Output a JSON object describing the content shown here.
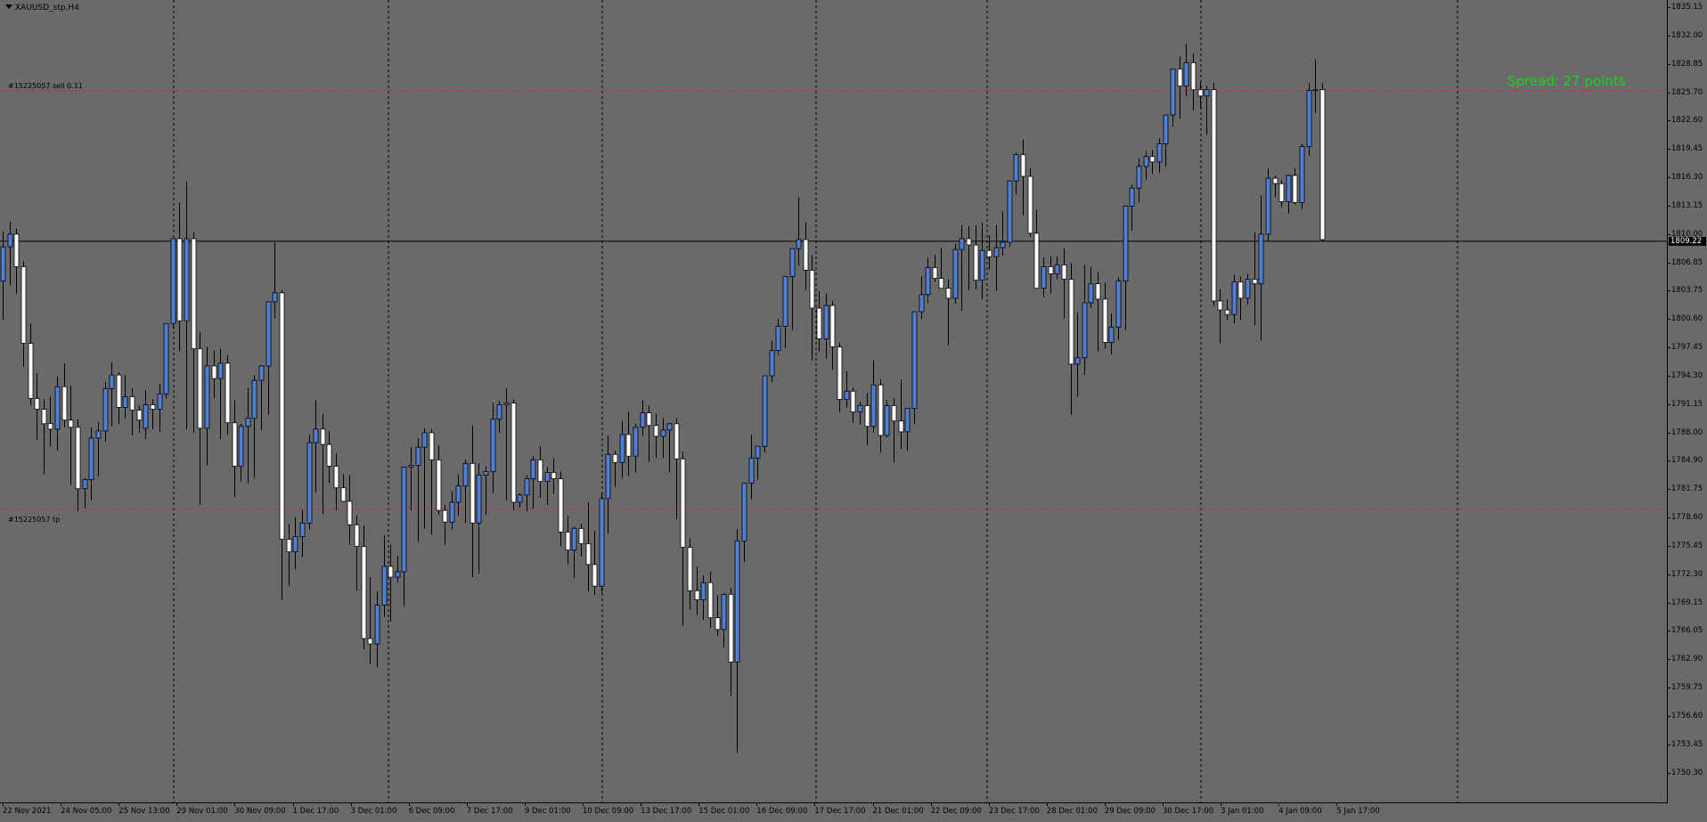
{
  "window": {
    "title": "XAUUSD_stp,H4",
    "menu_icon": "triangle-down-icon"
  },
  "colors": {
    "background": "#6a6a6a",
    "bull_body": "#4f7fd6",
    "bear_body": "#ffffff",
    "wick": "#000000",
    "order_line": "#c83232",
    "grid": "#000000",
    "spread_text": "#1cd41c"
  },
  "orders": {
    "entry_label": "#15225057 sell 0.11",
    "tp_label": "#15225057 tp",
    "entry_price": 1825.9,
    "tp_price": 1779.6
  },
  "spread_text": "Spread: 27 points",
  "bid_price": "1809.22",
  "price_axis": {
    "ticks": [
      "1835.15",
      "1832.00",
      "1828.85",
      "1825.70",
      "1822.60",
      "1819.45",
      "1816.30",
      "1813.15",
      "1810.00",
      "1806.85",
      "1803.75",
      "1800.60",
      "1797.45",
      "1794.30",
      "1791.15",
      "1788.00",
      "1784.90",
      "1781.75",
      "1778.60",
      "1775.45",
      "1772.30",
      "1769.15",
      "1766.05",
      "1762.90",
      "1759.75",
      "1756.60",
      "1753.45",
      "1750.30"
    ]
  },
  "time_axis": {
    "labels": [
      "22 Nov 2021",
      "24 Nov 05:00",
      "25 Nov 13:00",
      "29 Nov 01:00",
      "30 Nov 09:00",
      "1 Dec 17:00",
      "3 Dec 01:00",
      "6 Dec 09:00",
      "7 Dec 17:00",
      "9 Dec 01:00",
      "10 Dec 09:00",
      "13 Dec 17:00",
      "15 Dec 01:00",
      "16 Dec 09:00",
      "17 Dec 17:00",
      "21 Dec 01:00",
      "22 Dec 09:00",
      "23 Dec 17:00",
      "28 Dec 01:00",
      "29 Dec 09:00",
      "30 Dec 17:00",
      "3 Jan 01:00",
      "4 Jan 09:00",
      "5 Jan 17:00"
    ]
  },
  "chart_data": {
    "type": "candlestick",
    "symbol": "XAUUSD_stp",
    "timeframe": "H4",
    "ylim": [
      1750.3,
      1835.15
    ],
    "grid": "vertical-dashed",
    "candles": [
      [
        1804.8,
        1810.3,
        1800.5,
        1808.6
      ],
      [
        1808.6,
        1811.4,
        1804.3,
        1810.0
      ],
      [
        1810.0,
        1810.6,
        1803.4,
        1806.4
      ],
      [
        1806.4,
        1807.0,
        1795.3,
        1797.9
      ],
      [
        1797.9,
        1800.1,
        1791.0,
        1791.8
      ],
      [
        1791.8,
        1794.6,
        1787.2,
        1790.6
      ],
      [
        1790.6,
        1791.7,
        1783.4,
        1789.0
      ],
      [
        1789.0,
        1792.0,
        1786.5,
        1788.4
      ],
      [
        1788.4,
        1794.2,
        1786.0,
        1793.1
      ],
      [
        1793.1,
        1795.7,
        1788.6,
        1789.4
      ],
      [
        1789.4,
        1793.2,
        1782.2,
        1788.6
      ],
      [
        1788.6,
        1789.5,
        1779.3,
        1781.8
      ],
      [
        1781.8,
        1783.0,
        1779.6,
        1782.8
      ],
      [
        1782.8,
        1788.6,
        1780.5,
        1787.4
      ],
      [
        1787.4,
        1789.2,
        1783.2,
        1788.2
      ],
      [
        1788.2,
        1793.6,
        1787.0,
        1792.9
      ],
      [
        1792.9,
        1795.8,
        1788.7,
        1794.4
      ],
      [
        1794.4,
        1794.7,
        1789.0,
        1790.8
      ],
      [
        1790.8,
        1794.4,
        1789.6,
        1792.0
      ],
      [
        1792.0,
        1792.9,
        1787.7,
        1790.5
      ],
      [
        1790.5,
        1791.0,
        1788.0,
        1789.4
      ],
      [
        1788.5,
        1792.7,
        1787.3,
        1791.1
      ],
      [
        1791.1,
        1791.7,
        1788.4,
        1790.6
      ],
      [
        1790.6,
        1793.4,
        1788.1,
        1792.3
      ],
      [
        1792.3,
        1796.9,
        1791.7,
        1800.1
      ],
      [
        1800.1,
        1805.3,
        1799.5,
        1809.5
      ],
      [
        1809.5,
        1813.5,
        1797.0,
        1800.4
      ],
      [
        1800.4,
        1815.8,
        1788.4,
        1809.5
      ],
      [
        1809.5,
        1810.2,
        1788.0,
        1797.3
      ],
      [
        1797.3,
        1799.1,
        1780.0,
        1788.5
      ],
      [
        1788.5,
        1797.5,
        1784.4,
        1795.4
      ],
      [
        1795.4,
        1797.1,
        1791.8,
        1794.0
      ],
      [
        1794.0,
        1797.3,
        1787.3,
        1795.7
      ],
      [
        1795.7,
        1796.6,
        1787.8,
        1789.1
      ],
      [
        1789.1,
        1791.6,
        1780.9,
        1784.3
      ],
      [
        1784.3,
        1789.0,
        1782.6,
        1788.7
      ],
      [
        1788.7,
        1793.0,
        1782.4,
        1789.6
      ],
      [
        1789.6,
        1794.4,
        1783.0,
        1793.8
      ],
      [
        1793.8,
        1795.5,
        1788.3,
        1795.4
      ],
      [
        1795.4,
        1801.0,
        1790.0,
        1802.5
      ],
      [
        1802.5,
        1809.1,
        1800.7,
        1803.5
      ],
      [
        1803.5,
        1803.8,
        1769.5,
        1776.2
      ],
      [
        1776.2,
        1777.9,
        1771.0,
        1774.8
      ],
      [
        1774.8,
        1778.6,
        1772.9,
        1776.5
      ],
      [
        1776.5,
        1779.4,
        1774.2,
        1778.0
      ],
      [
        1778.0,
        1787.8,
        1777.3,
        1786.9
      ],
      [
        1786.9,
        1791.6,
        1781.4,
        1788.4
      ],
      [
        1788.4,
        1790.1,
        1779.0,
        1786.7
      ],
      [
        1786.7,
        1788.2,
        1782.4,
        1784.3
      ],
      [
        1784.3,
        1785.7,
        1779.4,
        1781.9
      ],
      [
        1781.9,
        1783.4,
        1780.6,
        1780.4
      ],
      [
        1780.4,
        1783.3,
        1775.6,
        1777.8
      ],
      [
        1777.8,
        1778.8,
        1770.5,
        1775.4
      ],
      [
        1775.4,
        1777.7,
        1764.0,
        1765.2
      ],
      [
        1765.2,
        1772.0,
        1762.4,
        1764.6
      ],
      [
        1764.6,
        1770.4,
        1762.0,
        1768.9
      ],
      [
        1768.9,
        1776.6,
        1767.6,
        1773.2
      ],
      [
        1773.2,
        1775.6,
        1767.1,
        1772.0
      ],
      [
        1772.0,
        1774.4,
        1771.4,
        1772.6
      ],
      [
        1772.6,
        1783.6,
        1768.8,
        1784.2
      ],
      [
        1784.2,
        1786.4,
        1779.4,
        1784.4
      ],
      [
        1784.4,
        1787.4,
        1775.9,
        1786.4
      ],
      [
        1786.4,
        1788.5,
        1777.4,
        1788.0
      ],
      [
        1788.0,
        1788.4,
        1776.7,
        1785.0
      ],
      [
        1785.0,
        1786.6,
        1778.9,
        1779.4
      ],
      [
        1779.4,
        1780.0,
        1775.6,
        1778.1
      ],
      [
        1778.1,
        1781.5,
        1777.3,
        1780.3
      ],
      [
        1780.3,
        1783.4,
        1778.8,
        1782.1
      ],
      [
        1782.1,
        1785.0,
        1778.0,
        1784.6
      ],
      [
        1784.6,
        1788.8,
        1772.0,
        1778.0
      ],
      [
        1778.0,
        1784.6,
        1772.4,
        1783.3
      ],
      [
        1783.3,
        1784.3,
        1778.9,
        1783.7
      ],
      [
        1783.7,
        1791.3,
        1781.3,
        1789.5
      ],
      [
        1789.5,
        1791.5,
        1788.0,
        1791.1
      ],
      [
        1791.1,
        1792.9,
        1780.5,
        1791.3
      ],
      [
        1791.3,
        1791.7,
        1779.4,
        1780.3
      ],
      [
        1780.3,
        1781.3,
        1779.7,
        1781.1
      ],
      [
        1781.1,
        1783.3,
        1779.3,
        1782.9
      ],
      [
        1782.9,
        1785.4,
        1779.6,
        1785.0
      ],
      [
        1785.0,
        1786.5,
        1780.8,
        1782.6
      ],
      [
        1782.6,
        1784.2,
        1780.0,
        1783.6
      ],
      [
        1783.6,
        1785.2,
        1781.2,
        1782.9
      ],
      [
        1782.9,
        1783.7,
        1775.4,
        1777.0
      ],
      [
        1777.0,
        1778.8,
        1773.4,
        1775.0
      ],
      [
        1775.0,
        1777.6,
        1771.9,
        1777.4
      ],
      [
        1777.4,
        1777.9,
        1774.3,
        1775.7
      ],
      [
        1775.7,
        1780.3,
        1770.4,
        1773.4
      ],
      [
        1773.4,
        1777.1,
        1770.0,
        1771.0
      ],
      [
        1771.0,
        1781.2,
        1770.2,
        1780.7
      ],
      [
        1780.7,
        1787.7,
        1776.8,
        1785.6
      ],
      [
        1785.6,
        1786.0,
        1782.0,
        1784.7
      ],
      [
        1784.7,
        1789.3,
        1783.0,
        1787.8
      ],
      [
        1787.8,
        1790.3,
        1783.2,
        1785.4
      ],
      [
        1785.4,
        1789.0,
        1783.6,
        1788.6
      ],
      [
        1788.6,
        1791.6,
        1787.6,
        1790.2
      ],
      [
        1790.2,
        1791.0,
        1784.8,
        1788.8
      ],
      [
        1788.8,
        1790.1,
        1785.2,
        1787.6
      ],
      [
        1787.6,
        1789.6,
        1785.2,
        1788.3
      ],
      [
        1788.3,
        1789.0,
        1783.6,
        1789.0
      ],
      [
        1789.0,
        1789.6,
        1778.4,
        1785.1
      ],
      [
        1785.1,
        1785.9,
        1766.6,
        1775.3
      ],
      [
        1775.3,
        1776.3,
        1768.4,
        1770.5
      ],
      [
        1770.5,
        1773.2,
        1767.8,
        1769.5
      ],
      [
        1769.5,
        1772.2,
        1767.3,
        1771.4
      ],
      [
        1771.4,
        1772.6,
        1766.4,
        1767.5
      ],
      [
        1767.5,
        1770.0,
        1765.5,
        1766.2
      ],
      [
        1766.2,
        1770.2,
        1764.2,
        1770.1
      ],
      [
        1770.1,
        1770.8,
        1758.8,
        1762.6
      ],
      [
        1762.6,
        1777.3,
        1752.5,
        1776.0
      ],
      [
        1776.0,
        1782.1,
        1773.7,
        1782.4
      ],
      [
        1782.4,
        1787.8,
        1780.6,
        1785.2
      ],
      [
        1785.2,
        1786.4,
        1782.8,
        1786.5
      ],
      [
        1786.5,
        1794.3,
        1785.8,
        1794.3
      ],
      [
        1794.3,
        1798.2,
        1793.6,
        1797.1
      ],
      [
        1797.1,
        1800.6,
        1796.6,
        1799.8
      ],
      [
        1799.8,
        1804.3,
        1797.4,
        1805.3
      ],
      [
        1805.3,
        1806.2,
        1799.4,
        1808.4
      ],
      [
        1808.4,
        1814.1,
        1806.5,
        1809.4
      ],
      [
        1809.4,
        1811.3,
        1803.8,
        1806.0
      ],
      [
        1806.0,
        1807.7,
        1796.0,
        1801.8
      ],
      [
        1801.8,
        1803.7,
        1797.0,
        1798.4
      ],
      [
        1798.4,
        1803.4,
        1796.2,
        1802.1
      ],
      [
        1802.1,
        1802.6,
        1795.0,
        1797.5
      ],
      [
        1797.5,
        1798.0,
        1790.3,
        1791.7
      ],
      [
        1791.7,
        1794.8,
        1790.8,
        1792.6
      ],
      [
        1792.6,
        1793.0,
        1789.1,
        1790.3
      ],
      [
        1790.3,
        1791.4,
        1788.9,
        1791.0
      ],
      [
        1791.0,
        1792.4,
        1786.6,
        1788.7
      ],
      [
        1788.7,
        1796.0,
        1788.0,
        1793.3
      ],
      [
        1793.3,
        1793.9,
        1785.8,
        1787.7
      ],
      [
        1787.7,
        1791.6,
        1787.5,
        1791.0
      ],
      [
        1791.0,
        1791.8,
        1784.7,
        1789.3
      ],
      [
        1789.3,
        1793.9,
        1786.2,
        1788.1
      ],
      [
        1788.1,
        1789.7,
        1786.0,
        1790.7
      ],
      [
        1790.7,
        1801.3,
        1789.0,
        1801.4
      ],
      [
        1801.4,
        1805.3,
        1800.6,
        1803.3
      ],
      [
        1803.3,
        1807.4,
        1802.4,
        1806.3
      ],
      [
        1806.3,
        1807.7,
        1804.7,
        1805.1
      ],
      [
        1805.1,
        1808.5,
        1804.0,
        1804.0
      ],
      [
        1804.0,
        1805.0,
        1797.7,
        1802.9
      ],
      [
        1802.9,
        1808.9,
        1802.3,
        1808.3
      ],
      [
        1808.3,
        1811.0,
        1801.5,
        1809.5
      ],
      [
        1809.5,
        1810.9,
        1803.8,
        1808.8
      ],
      [
        1808.8,
        1811.0,
        1803.9,
        1804.9
      ],
      [
        1804.9,
        1811.3,
        1802.8,
        1808.2
      ],
      [
        1808.2,
        1809.9,
        1806.1,
        1807.5
      ],
      [
        1807.5,
        1811.0,
        1803.7,
        1808.5
      ],
      [
        1808.5,
        1812.5,
        1807.6,
        1809.1
      ],
      [
        1809.1,
        1815.3,
        1808.6,
        1815.9
      ],
      [
        1815.9,
        1819.0,
        1814.4,
        1818.8
      ],
      [
        1818.8,
        1820.5,
        1812.1,
        1816.4
      ],
      [
        1816.4,
        1817.3,
        1809.7,
        1810.1
      ],
      [
        1810.1,
        1812.7,
        1804.1,
        1804.0
      ],
      [
        1804.0,
        1807.4,
        1803.0,
        1806.4
      ],
      [
        1806.4,
        1807.5,
        1803.4,
        1805.6
      ],
      [
        1805.6,
        1807.5,
        1805.0,
        1806.6
      ],
      [
        1806.6,
        1808.4,
        1800.7,
        1805.0
      ],
      [
        1805.0,
        1806.8,
        1790.0,
        1795.6
      ],
      [
        1795.6,
        1801.3,
        1792.0,
        1796.3
      ],
      [
        1796.3,
        1806.6,
        1794.4,
        1802.4
      ],
      [
        1802.4,
        1806.4,
        1801.8,
        1804.5
      ],
      [
        1804.5,
        1805.8,
        1797.0,
        1802.8
      ],
      [
        1802.8,
        1804.6,
        1797.3,
        1798.0
      ],
      [
        1798.0,
        1801.2,
        1796.7,
        1799.7
      ],
      [
        1799.7,
        1805.2,
        1798.3,
        1804.8
      ],
      [
        1804.8,
        1808.9,
        1799.4,
        1813.1
      ],
      [
        1813.1,
        1815.5,
        1810.4,
        1815.1
      ],
      [
        1815.1,
        1818.4,
        1813.5,
        1817.5
      ],
      [
        1817.5,
        1819.2,
        1816.0,
        1818.6
      ],
      [
        1818.6,
        1819.3,
        1816.7,
        1818.0
      ],
      [
        1818.0,
        1820.6,
        1816.8,
        1820.0
      ],
      [
        1820.0,
        1822.9,
        1817.5,
        1823.2
      ],
      [
        1823.2,
        1826.8,
        1821.9,
        1828.3
      ],
      [
        1828.3,
        1829.7,
        1822.8,
        1826.4
      ],
      [
        1826.4,
        1831.1,
        1825.3,
        1829.0
      ],
      [
        1829.0,
        1830.0,
        1823.7,
        1826.0
      ],
      [
        1826.0,
        1826.8,
        1824.0,
        1825.3
      ],
      [
        1825.3,
        1826.5,
        1821.0,
        1826.0
      ],
      [
        1826.0,
        1826.8,
        1802.0,
        1802.6
      ],
      [
        1802.6,
        1803.9,
        1797.9,
        1801.6
      ],
      [
        1801.6,
        1802.8,
        1800.5,
        1801.1
      ],
      [
        1801.1,
        1805.5,
        1800.1,
        1804.7
      ],
      [
        1804.7,
        1805.3,
        1800.5,
        1802.9
      ],
      [
        1802.9,
        1805.6,
        1802.2,
        1805.0
      ],
      [
        1805.0,
        1810.2,
        1799.9,
        1804.5
      ],
      [
        1804.5,
        1814.3,
        1798.2,
        1810.0
      ],
      [
        1810.0,
        1817.3,
        1809.2,
        1816.2
      ],
      [
        1816.2,
        1816.5,
        1814.1,
        1815.6
      ],
      [
        1815.6,
        1816.0,
        1813.0,
        1813.6
      ],
      [
        1813.6,
        1816.6,
        1812.3,
        1816.5
      ],
      [
        1816.5,
        1817.3,
        1813.3,
        1813.5
      ],
      [
        1813.5,
        1820.0,
        1812.8,
        1819.7
      ],
      [
        1819.7,
        1826.7,
        1818.7,
        1825.9
      ],
      [
        1825.9,
        1829.4,
        1823.4,
        1826.0
      ],
      [
        1826.0,
        1826.7,
        1809.2,
        1809.4
      ]
    ]
  }
}
